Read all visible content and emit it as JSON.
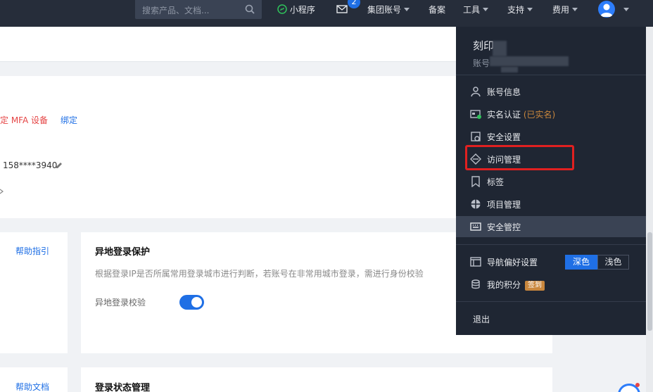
{
  "topbar": {
    "search_placeholder": "搜索产品、文档...",
    "mini_program": "小程序",
    "mail_count": "2",
    "group_account": "集团账号",
    "filing": "备案",
    "tools": "工具",
    "support": "支持",
    "billing": "费用"
  },
  "main": {
    "mfa_text": "绑定 MFA 设备",
    "bind_link": "绑定",
    "phone": "158****3940",
    "help_guide": "帮助指引",
    "help_doc": "帮助文档",
    "remote_login_title": "异地登录保护",
    "remote_login_desc": "根据登录IP是否所属常用登录城市进行判断，若账号在非常用城市登录，需进行身份校验",
    "remote_login_toggle_label": "异地登录校验",
    "remote_login_enabled": true,
    "login_state_title": "登录状态管理"
  },
  "panel": {
    "username": "刻印",
    "account_id_label": "账号",
    "items": [
      {
        "label": "账号信息",
        "icon": "user-icon"
      },
      {
        "label": "实名认证",
        "extra": "(已实名)",
        "icon": "id-card-icon"
      },
      {
        "label": "安全设置",
        "icon": "shield-icon"
      },
      {
        "label": "访问管理",
        "icon": "access-icon"
      },
      {
        "label": "标签",
        "icon": "bookmark-icon"
      },
      {
        "label": "项目管理",
        "icon": "project-icon"
      },
      {
        "label": "安全管控",
        "icon": "keyboard-icon"
      }
    ],
    "nav_pref_label": "导航偏好设置",
    "theme_dark": "深色",
    "theme_light": "浅色",
    "points_label": "我的积分",
    "checkin_badge": "签到",
    "logout": "退出"
  },
  "colors": {
    "topbar": "#262d3a",
    "panel": "#1f2633",
    "accent": "#1f6fe5",
    "highlight_box": "#e02020",
    "danger_text": "#e54545"
  }
}
